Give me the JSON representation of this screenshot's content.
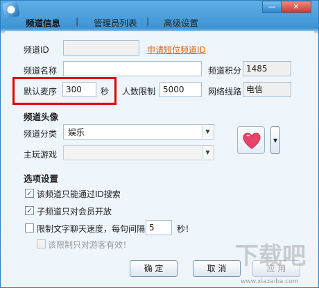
{
  "window": {
    "minimize": "—",
    "close": "✕"
  },
  "tabs": {
    "info": "频道信息",
    "sep1": "|",
    "admins": "管理员列表",
    "sep2": "|",
    "advanced": "高级设置"
  },
  "channel_id": {
    "label": "频道ID",
    "value": "",
    "link": "申请短位频道ID"
  },
  "channel_name": {
    "label": "频道名称",
    "value": ""
  },
  "channel_points": {
    "label": "频道积分",
    "value": "1485"
  },
  "default_mic": {
    "label": "默认麦序",
    "value": "300",
    "unit": "秒"
  },
  "user_limit": {
    "label": "人数限制",
    "value": "5000"
  },
  "network": {
    "label": "网络线路",
    "value": "电信"
  },
  "avatar_section": {
    "title": "频道头像",
    "category_label": "频道分类",
    "category_value": "娱乐",
    "game_label": "主玩游戏",
    "game_value": "",
    "icon": "heart-icon",
    "dropdown_icon": "▾"
  },
  "options": {
    "title": "选项设置",
    "items": [
      {
        "label": "该频道只能通过ID搜索",
        "checked": true
      },
      {
        "label": "子频道只对会员开放",
        "checked": true
      },
      {
        "label": "限制文字聊天速度，每句间隔",
        "checked": false,
        "value": "5",
        "unit": "秒！"
      },
      {
        "label": "该限制只对游客有效！",
        "checked": false,
        "disabled": true
      }
    ]
  },
  "buttons": {
    "ok": "确 定",
    "cancel": "取 消",
    "apply": "应 用"
  },
  "watermark": {
    "text": "下载吧",
    "url": "www.xiazaiba.com"
  },
  "colors": {
    "title_bar": "#3d93d3",
    "highlight": "#e00000",
    "link": "#e0670f",
    "heart": "#e8436a"
  }
}
